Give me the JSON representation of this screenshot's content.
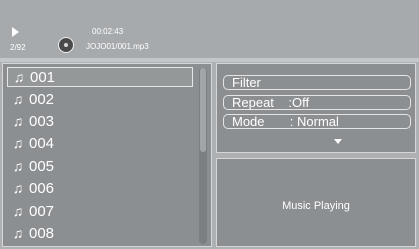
{
  "player": {
    "state_icon": "play-icon",
    "track_counter": "2/92",
    "elapsed_time": "00:02:43",
    "media_icon": "disc-icon",
    "file_name": "JOJO01/001.mp3"
  },
  "playlist": {
    "item_icon": "music-note-icon",
    "items": [
      "001",
      "002",
      "003",
      "004",
      "005",
      "006",
      "007",
      "008"
    ],
    "selected_index": 0
  },
  "menu": {
    "filter_label": "Filter",
    "repeat_label": "Repeat    :Off",
    "mode_label": "Mode       : Normal",
    "more_icon": "chevron-down-icon"
  },
  "status": {
    "text": "Music Playing"
  },
  "colors": {
    "background": "#aeb1b4",
    "panel": "#8c8f92",
    "text": "#ffffff"
  }
}
